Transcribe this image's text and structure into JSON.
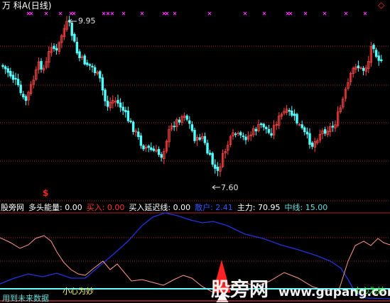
{
  "header": {
    "title": "万 科A(日线)",
    "corner_symbol": "◇"
  },
  "price_panel": {
    "high_label": "9.95",
    "low_label": "7.60",
    "signal_glyph": "$"
  },
  "indicator_bar": {
    "name": "股旁网",
    "bull_energy": "多头能量: 0.00",
    "buy": "买入: 0.00",
    "buy_delay": "买入延迟线: 0.00",
    "retail": "散户: 2.41",
    "main_force": "主力: 70.95",
    "middle_line": "中线: 15.00"
  },
  "indicator_notes": {
    "careful": "小心为妙",
    "bottom_hint": "用到未来数据",
    "right_hint": "小心为妙"
  },
  "watermark": {
    "text": "股旁网",
    "url": "www.gupang.com"
  },
  "colors": {
    "background": "#000000",
    "up_candle": "#ff4444",
    "down_candle": "#54ffff",
    "grid": "#aa2222",
    "marker": "#ff33ff",
    "retail_line": "#2233dd",
    "main_line": "#ff9988",
    "middle_line": "#66ffff"
  }
}
